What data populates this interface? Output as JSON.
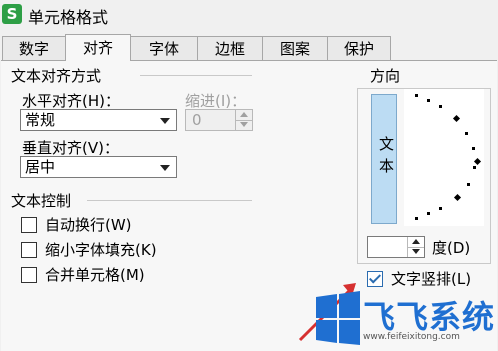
{
  "window": {
    "app_icon": "S",
    "title": "单元格格式"
  },
  "tabs": [
    {
      "label": "数字"
    },
    {
      "label": "对齐"
    },
    {
      "label": "字体"
    },
    {
      "label": "边框"
    },
    {
      "label": "图案"
    },
    {
      "label": "保护"
    }
  ],
  "active_tab": "对齐",
  "alignment": {
    "section_title": "文本对齐方式",
    "horizontal_label": "水平对齐(H)：",
    "horizontal_value": "常规",
    "indent_label": "缩进(I)：",
    "indent_value": "0",
    "vertical_label": "垂直对齐(V)：",
    "vertical_value": "居中"
  },
  "text_control": {
    "section_title": "文本控制",
    "wrap_text": {
      "label": "自动换行(W)",
      "checked": false
    },
    "shrink_to_fit": {
      "label": "缩小字体填充(K)",
      "checked": false
    },
    "merge_cells": {
      "label": "合并单元格(M)",
      "checked": false
    }
  },
  "orientation": {
    "section_title": "方向",
    "vertical_text_chars": [
      "文",
      "本"
    ],
    "degrees_value": "",
    "degrees_label": "度(D)",
    "vertical_text": {
      "label": "文字竖排(L)",
      "checked": true
    }
  },
  "watermark": {
    "text": "飞飞系统",
    "url": "www.feifeixitong.com"
  },
  "colors": {
    "accent": "#2b6cb0",
    "vertical_button": "#bcdcf3",
    "watermark": "#1f6fd1"
  }
}
